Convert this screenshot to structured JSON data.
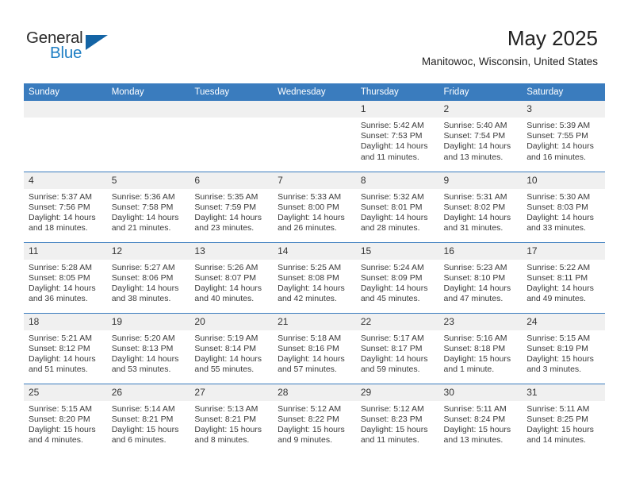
{
  "brand": {
    "name_top": "General",
    "name_bottom": "Blue",
    "triangle_color": "#1464a5",
    "blue_text_color": "#1f7fc4"
  },
  "header": {
    "month_title": "May 2025",
    "location": "Manitowoc, Wisconsin, United States",
    "header_bar_color": "#3a7cbe"
  },
  "weekday_headers": [
    "Sunday",
    "Monday",
    "Tuesday",
    "Wednesday",
    "Thursday",
    "Friday",
    "Saturday"
  ],
  "weeks": [
    [
      {
        "day": "",
        "sunrise": "",
        "sunset": "",
        "daylight": "",
        "empty": true
      },
      {
        "day": "",
        "sunrise": "",
        "sunset": "",
        "daylight": "",
        "empty": true
      },
      {
        "day": "",
        "sunrise": "",
        "sunset": "",
        "daylight": "",
        "empty": true
      },
      {
        "day": "",
        "sunrise": "",
        "sunset": "",
        "daylight": "",
        "empty": true
      },
      {
        "day": "1",
        "sunrise": "Sunrise: 5:42 AM",
        "sunset": "Sunset: 7:53 PM",
        "daylight": "Daylight: 14 hours and 11 minutes.",
        "empty": false
      },
      {
        "day": "2",
        "sunrise": "Sunrise: 5:40 AM",
        "sunset": "Sunset: 7:54 PM",
        "daylight": "Daylight: 14 hours and 13 minutes.",
        "empty": false
      },
      {
        "day": "3",
        "sunrise": "Sunrise: 5:39 AM",
        "sunset": "Sunset: 7:55 PM",
        "daylight": "Daylight: 14 hours and 16 minutes.",
        "empty": false
      }
    ],
    [
      {
        "day": "4",
        "sunrise": "Sunrise: 5:37 AM",
        "sunset": "Sunset: 7:56 PM",
        "daylight": "Daylight: 14 hours and 18 minutes.",
        "empty": false
      },
      {
        "day": "5",
        "sunrise": "Sunrise: 5:36 AM",
        "sunset": "Sunset: 7:58 PM",
        "daylight": "Daylight: 14 hours and 21 minutes.",
        "empty": false
      },
      {
        "day": "6",
        "sunrise": "Sunrise: 5:35 AM",
        "sunset": "Sunset: 7:59 PM",
        "daylight": "Daylight: 14 hours and 23 minutes.",
        "empty": false
      },
      {
        "day": "7",
        "sunrise": "Sunrise: 5:33 AM",
        "sunset": "Sunset: 8:00 PM",
        "daylight": "Daylight: 14 hours and 26 minutes.",
        "empty": false
      },
      {
        "day": "8",
        "sunrise": "Sunrise: 5:32 AM",
        "sunset": "Sunset: 8:01 PM",
        "daylight": "Daylight: 14 hours and 28 minutes.",
        "empty": false
      },
      {
        "day": "9",
        "sunrise": "Sunrise: 5:31 AM",
        "sunset": "Sunset: 8:02 PM",
        "daylight": "Daylight: 14 hours and 31 minutes.",
        "empty": false
      },
      {
        "day": "10",
        "sunrise": "Sunrise: 5:30 AM",
        "sunset": "Sunset: 8:03 PM",
        "daylight": "Daylight: 14 hours and 33 minutes.",
        "empty": false
      }
    ],
    [
      {
        "day": "11",
        "sunrise": "Sunrise: 5:28 AM",
        "sunset": "Sunset: 8:05 PM",
        "daylight": "Daylight: 14 hours and 36 minutes.",
        "empty": false
      },
      {
        "day": "12",
        "sunrise": "Sunrise: 5:27 AM",
        "sunset": "Sunset: 8:06 PM",
        "daylight": "Daylight: 14 hours and 38 minutes.",
        "empty": false
      },
      {
        "day": "13",
        "sunrise": "Sunrise: 5:26 AM",
        "sunset": "Sunset: 8:07 PM",
        "daylight": "Daylight: 14 hours and 40 minutes.",
        "empty": false
      },
      {
        "day": "14",
        "sunrise": "Sunrise: 5:25 AM",
        "sunset": "Sunset: 8:08 PM",
        "daylight": "Daylight: 14 hours and 42 minutes.",
        "empty": false
      },
      {
        "day": "15",
        "sunrise": "Sunrise: 5:24 AM",
        "sunset": "Sunset: 8:09 PM",
        "daylight": "Daylight: 14 hours and 45 minutes.",
        "empty": false
      },
      {
        "day": "16",
        "sunrise": "Sunrise: 5:23 AM",
        "sunset": "Sunset: 8:10 PM",
        "daylight": "Daylight: 14 hours and 47 minutes.",
        "empty": false
      },
      {
        "day": "17",
        "sunrise": "Sunrise: 5:22 AM",
        "sunset": "Sunset: 8:11 PM",
        "daylight": "Daylight: 14 hours and 49 minutes.",
        "empty": false
      }
    ],
    [
      {
        "day": "18",
        "sunrise": "Sunrise: 5:21 AM",
        "sunset": "Sunset: 8:12 PM",
        "daylight": "Daylight: 14 hours and 51 minutes.",
        "empty": false
      },
      {
        "day": "19",
        "sunrise": "Sunrise: 5:20 AM",
        "sunset": "Sunset: 8:13 PM",
        "daylight": "Daylight: 14 hours and 53 minutes.",
        "empty": false
      },
      {
        "day": "20",
        "sunrise": "Sunrise: 5:19 AM",
        "sunset": "Sunset: 8:14 PM",
        "daylight": "Daylight: 14 hours and 55 minutes.",
        "empty": false
      },
      {
        "day": "21",
        "sunrise": "Sunrise: 5:18 AM",
        "sunset": "Sunset: 8:16 PM",
        "daylight": "Daylight: 14 hours and 57 minutes.",
        "empty": false
      },
      {
        "day": "22",
        "sunrise": "Sunrise: 5:17 AM",
        "sunset": "Sunset: 8:17 PM",
        "daylight": "Daylight: 14 hours and 59 minutes.",
        "empty": false
      },
      {
        "day": "23",
        "sunrise": "Sunrise: 5:16 AM",
        "sunset": "Sunset: 8:18 PM",
        "daylight": "Daylight: 15 hours and 1 minute.",
        "empty": false
      },
      {
        "day": "24",
        "sunrise": "Sunrise: 5:15 AM",
        "sunset": "Sunset: 8:19 PM",
        "daylight": "Daylight: 15 hours and 3 minutes.",
        "empty": false
      }
    ],
    [
      {
        "day": "25",
        "sunrise": "Sunrise: 5:15 AM",
        "sunset": "Sunset: 8:20 PM",
        "daylight": "Daylight: 15 hours and 4 minutes.",
        "empty": false
      },
      {
        "day": "26",
        "sunrise": "Sunrise: 5:14 AM",
        "sunset": "Sunset: 8:21 PM",
        "daylight": "Daylight: 15 hours and 6 minutes.",
        "empty": false
      },
      {
        "day": "27",
        "sunrise": "Sunrise: 5:13 AM",
        "sunset": "Sunset: 8:21 PM",
        "daylight": "Daylight: 15 hours and 8 minutes.",
        "empty": false
      },
      {
        "day": "28",
        "sunrise": "Sunrise: 5:12 AM",
        "sunset": "Sunset: 8:22 PM",
        "daylight": "Daylight: 15 hours and 9 minutes.",
        "empty": false
      },
      {
        "day": "29",
        "sunrise": "Sunrise: 5:12 AM",
        "sunset": "Sunset: 8:23 PM",
        "daylight": "Daylight: 15 hours and 11 minutes.",
        "empty": false
      },
      {
        "day": "30",
        "sunrise": "Sunrise: 5:11 AM",
        "sunset": "Sunset: 8:24 PM",
        "daylight": "Daylight: 15 hours and 13 minutes.",
        "empty": false
      },
      {
        "day": "31",
        "sunrise": "Sunrise: 5:11 AM",
        "sunset": "Sunset: 8:25 PM",
        "daylight": "Daylight: 15 hours and 14 minutes.",
        "empty": false
      }
    ]
  ]
}
